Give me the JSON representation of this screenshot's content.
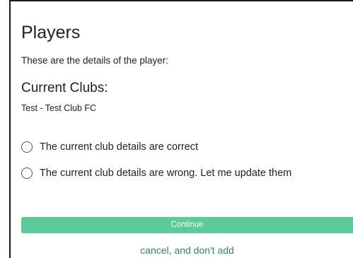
{
  "page": {
    "title": "Players",
    "intro": "These are the details of the player:"
  },
  "clubs": {
    "heading": "Current Clubs:",
    "entries": [
      "Test - Test Club FC"
    ]
  },
  "options": [
    {
      "label": "The current club details are correct",
      "selected": false
    },
    {
      "label": "The current club details are wrong. Let me update them",
      "selected": false
    }
  ],
  "actions": {
    "continue_label": "Continue",
    "cancel_label": "cancel, and don't add"
  },
  "colors": {
    "accent": "#5ccb9b",
    "link": "#2e8b57"
  }
}
